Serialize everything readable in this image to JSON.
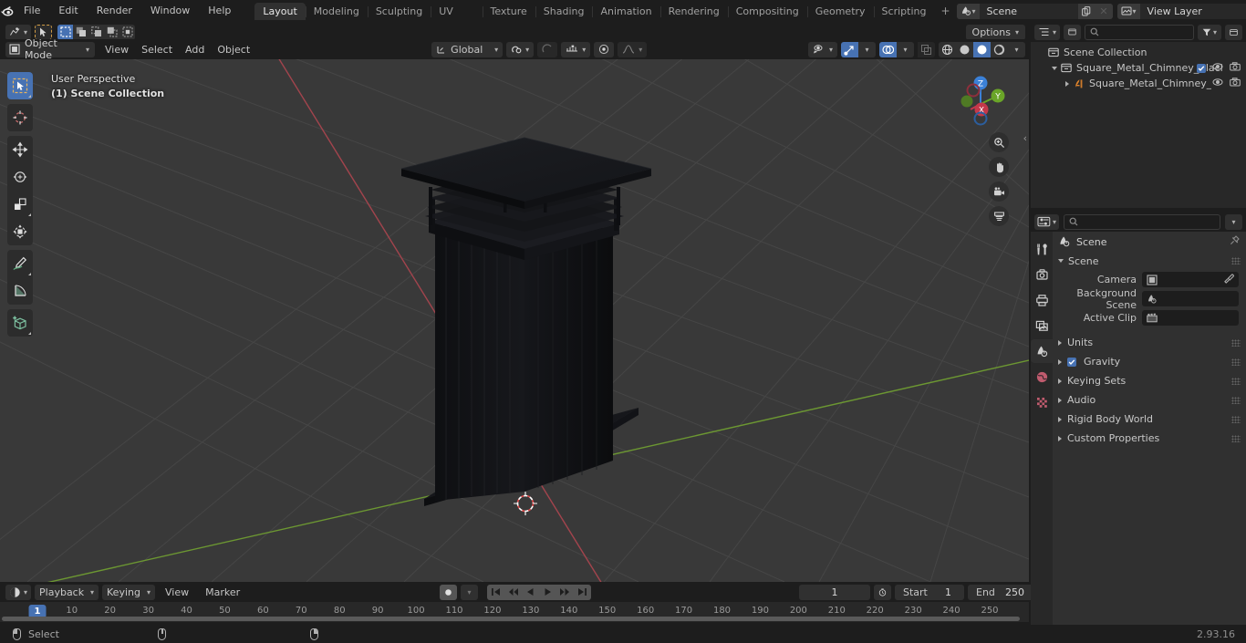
{
  "topbar": {
    "logo": "blender-logo",
    "menus": [
      "File",
      "Edit",
      "Render",
      "Window",
      "Help"
    ],
    "workspaces": [
      {
        "label": "Layout",
        "active": true
      },
      {
        "label": "Modeling",
        "active": false
      },
      {
        "label": "Sculpting",
        "active": false
      },
      {
        "label": "UV Editing",
        "active": false
      },
      {
        "label": "Texture Paint",
        "active": false
      },
      {
        "label": "Shading",
        "active": false
      },
      {
        "label": "Animation",
        "active": false
      },
      {
        "label": "Rendering",
        "active": false
      },
      {
        "label": "Compositing",
        "active": false
      },
      {
        "label": "Geometry Nodes",
        "active": false
      },
      {
        "label": "Scripting",
        "active": false
      }
    ],
    "add_workspace": "+",
    "scene_name": "Scene",
    "view_layer_name": "View Layer"
  },
  "viewport_header": {
    "mode": "Object Mode",
    "menus": [
      "View",
      "Select",
      "Add",
      "Object"
    ],
    "transform_orientation": "Global",
    "options_label": "Options"
  },
  "viewport": {
    "perspective": "User Perspective",
    "collection": "(1) Scene Collection",
    "gizmo_axes": [
      "X",
      "Y",
      "Z"
    ],
    "background_color": "#393939",
    "grid_color": "#4b4b4b",
    "x_axis_color": "#a5444b",
    "y_axis_color": "#6a9a2f",
    "object_color": "#15161a",
    "cursor_color": "#e24c4c"
  },
  "toolbar": {
    "tools": [
      {
        "name": "select-box-tool",
        "active": true
      },
      {
        "name": "cursor-tool",
        "active": false
      },
      {
        "name": "move-tool",
        "active": false
      },
      {
        "name": "rotate-tool",
        "active": false
      },
      {
        "name": "scale-tool",
        "active": false
      },
      {
        "name": "transform-tool",
        "active": false
      },
      {
        "name": "annotate-tool",
        "active": false
      },
      {
        "name": "measure-tool",
        "active": false
      },
      {
        "name": "add-cube-tool",
        "active": false
      }
    ]
  },
  "outliner": {
    "search_placeholder": "",
    "rows": [
      {
        "label": "Scene Collection",
        "indent": 0,
        "icon": "collection-icon",
        "disclosure": "",
        "checkbox": false,
        "eye": false,
        "camera": false
      },
      {
        "label": "Square_Metal_Chimney_Blacl",
        "indent": 1,
        "icon": "collection-icon",
        "disclosure": "down",
        "checkbox": true,
        "eye": true,
        "camera": true
      },
      {
        "label": "Square_Metal_Chimney_",
        "indent": 2,
        "icon": "mesh-data-icon",
        "disclosure": "right",
        "checkbox": false,
        "eye": true,
        "camera": true
      }
    ]
  },
  "properties": {
    "breadcrumb": "Scene",
    "tabs": [
      {
        "name": "tool-tab",
        "active": false
      },
      {
        "name": "render-tab",
        "active": false
      },
      {
        "name": "output-tab",
        "active": false
      },
      {
        "name": "view-layer-tab",
        "active": false
      },
      {
        "name": "scene-tab",
        "active": true
      },
      {
        "name": "world-tab",
        "active": false
      },
      {
        "name": "texture-tab",
        "active": false
      }
    ],
    "panel_title": "Scene",
    "fields": [
      {
        "label": "Camera",
        "value": "",
        "icon": "camera-object-icon",
        "eyedropper": true
      },
      {
        "label": "Background Scene",
        "value": "",
        "icon": "scene-icon",
        "eyedropper": false
      },
      {
        "label": "Active Clip",
        "value": "",
        "icon": "clip-icon",
        "eyedropper": false
      }
    ],
    "sections": [
      {
        "label": "Units",
        "checkbox": null
      },
      {
        "label": "Gravity",
        "checkbox": true
      },
      {
        "label": "Keying Sets",
        "checkbox": null
      },
      {
        "label": "Audio",
        "checkbox": null
      },
      {
        "label": "Rigid Body World",
        "checkbox": null
      },
      {
        "label": "Custom Properties",
        "checkbox": null
      }
    ]
  },
  "timeline": {
    "editor_icon": "timeline-icon",
    "menus": [
      "Playback",
      "Keying",
      "View",
      "Marker"
    ],
    "current_frame": "1",
    "start_label": "Start",
    "start_value": "1",
    "end_label": "End",
    "end_value": "250",
    "ruler_ticks": [
      "10",
      "20",
      "30",
      "40",
      "50",
      "60",
      "70",
      "80",
      "90",
      "100",
      "110",
      "120",
      "130",
      "140",
      "150",
      "160",
      "170",
      "180",
      "190",
      "200",
      "210",
      "220",
      "230",
      "240",
      "250"
    ],
    "playhead_label": "1"
  },
  "statusbar": {
    "select_label": "Select",
    "version": "2.93.16"
  }
}
